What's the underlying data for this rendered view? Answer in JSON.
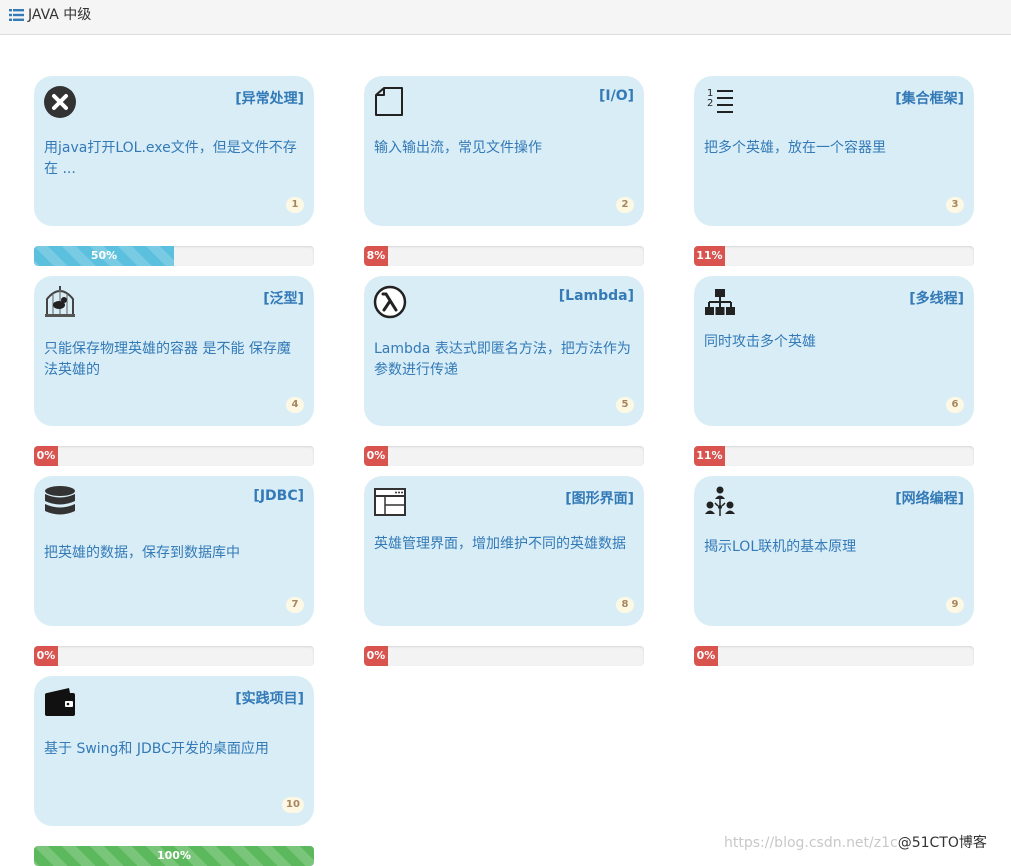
{
  "header": {
    "title": "JAVA 中级",
    "icon": "list-icon"
  },
  "cards": [
    {
      "category": "[异常处理]",
      "description": "用java打开LOL.exe文件，但是文件不存在 ...",
      "number": "1",
      "icon": "error-circle-icon",
      "progress": "50%",
      "status": "info"
    },
    {
      "category": "[I/O]",
      "description": "输入输出流，常见文件操作",
      "number": "2",
      "icon": "file-icon",
      "progress": "8%",
      "status": "danger"
    },
    {
      "category": "[集合框架]",
      "description": "把多个英雄，放在一个容器里",
      "number": "3",
      "icon": "numbered-list-icon",
      "progress": "11%",
      "status": "danger"
    },
    {
      "category": "[泛型]",
      "description": "只能保存物理英雄的容器 是不能 保存魔法英雄的",
      "number": "4",
      "icon": "birdcage-icon",
      "progress": "0%",
      "status": "danger"
    },
    {
      "category": "[Lambda]",
      "description": "Lambda 表达式即匿名方法，把方法作为参数进行传递",
      "number": "5",
      "icon": "lambda-icon",
      "progress": "0%",
      "status": "danger"
    },
    {
      "category": "[多线程]",
      "description": "同时攻击多个英雄",
      "number": "6",
      "icon": "sitemap-icon",
      "progress": "11%",
      "status": "danger"
    },
    {
      "category": "[JDBC]",
      "description": "把英雄的数据，保存到数据库中",
      "number": "7",
      "icon": "database-icon",
      "progress": "0%",
      "status": "danger"
    },
    {
      "category": "[图形界面]",
      "description": "英雄管理界面，增加维护不同的英雄数据",
      "number": "8",
      "icon": "window-icon",
      "progress": "0%",
      "status": "danger"
    },
    {
      "category": "[网络编程]",
      "description": "揭示LOL联机的基本原理",
      "number": "9",
      "icon": "network-users-icon",
      "progress": "0%",
      "status": "danger"
    },
    {
      "category": "[实践项目]",
      "description": "基于 Swing和 JDBC开发的桌面应用",
      "number": "10",
      "icon": "wallet-icon",
      "progress": "100%",
      "status": "success"
    }
  ],
  "watermark": {
    "url": "https://blog.csdn.net/z1c",
    "brand": "@51CTO博客"
  },
  "colors": {
    "card_bg": "#d9edf7",
    "link_text": "#337ab7",
    "progress_info": "#5bc0de",
    "progress_danger": "#d9534f",
    "progress_success": "#5cb85c",
    "badge_bg": "#fcf8e3"
  }
}
